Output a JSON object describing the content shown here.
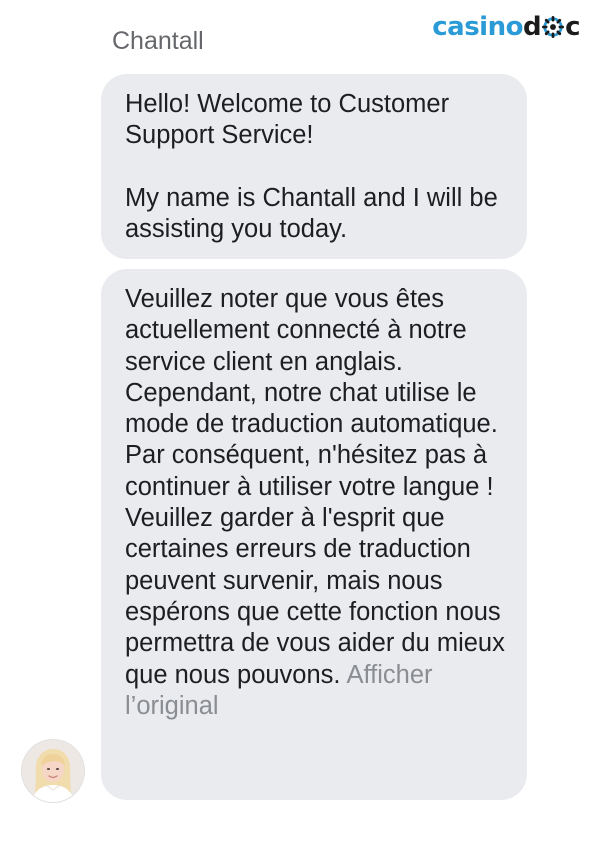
{
  "brand": {
    "logo_part1": "casino",
    "logo_part2_pre": "d",
    "logo_part2_post": "c",
    "logo_icon": "gear-icon",
    "accent_color": "#2a9bd6"
  },
  "chat": {
    "sender_name": "Chantall",
    "messages": [
      {
        "paragraph_1": "Hello! Welcome to Customer Support Service!",
        "paragraph_2": "My name is Chantall and I will be assisting you today."
      },
      {
        "paragraph_1": "Veuillez noter que vous êtes actuellement connecté à notre service client en anglais. Cependant, notre chat utilise le mode de traduction automatique. Par conséquent, n'hésitez pas à continuer à utiliser votre langue !",
        "paragraph_2": "Veuillez garder à l'esprit que certaines erreurs de traduction peuvent survenir, mais nous espérons que cette fonction nous permettra de vous aider du mieux que nous pouvons.",
        "show_original_link": "Afficher l’original"
      }
    ],
    "bubble_color": "#e9ebee",
    "avatar_icon": "agent-avatar"
  }
}
